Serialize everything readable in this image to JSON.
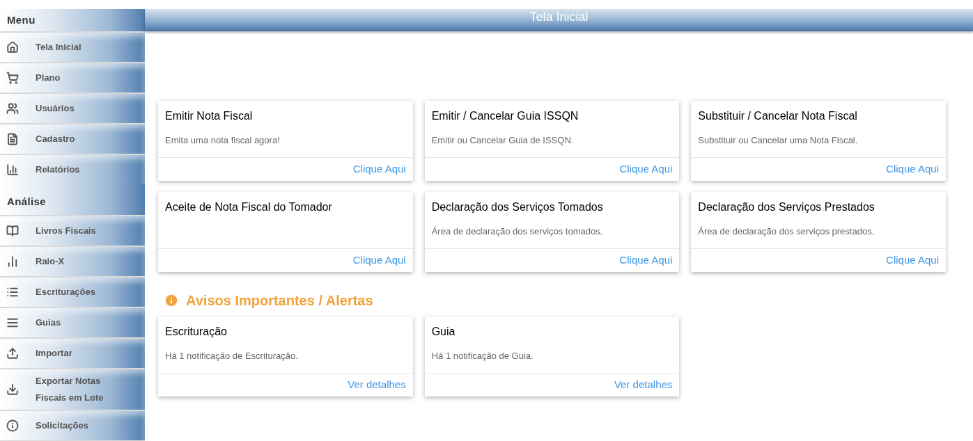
{
  "sidebar": {
    "sections": [
      {
        "title": "Menu",
        "items": [
          {
            "label": "Tela Inicial"
          },
          {
            "label": "Plano"
          },
          {
            "label": "Usuários"
          },
          {
            "label": "Cadastro"
          },
          {
            "label": "Relatórios"
          }
        ]
      },
      {
        "title": "Análise",
        "items": [
          {
            "label": "Livros Fiscais"
          },
          {
            "label": "Raio-X"
          },
          {
            "label": "Escriturações"
          },
          {
            "label": "Guias"
          },
          {
            "label": "Importar"
          },
          {
            "label": "Exportar Notas Fiscais em Lote"
          },
          {
            "label": "Solicitações"
          }
        ]
      }
    ]
  },
  "header": {
    "title": "Tela Inicial"
  },
  "cards": [
    {
      "title": "Emitir Nota Fiscal",
      "description": "Emita uma nota fiscal agora!",
      "link": "Clique Aqui"
    },
    {
      "title": "Emitir / Cancelar Guia ISSQN",
      "description": "Emitir ou Cancelar Guia de ISSQN.",
      "link": "Clique Aqui"
    },
    {
      "title": "Substituir / Cancelar Nota Fiscal",
      "description": "Substituir ou Cancelar uma Nota Fiscal.",
      "link": "Clique Aqui"
    },
    {
      "title": "Aceite de Nota Fiscal do Tomador",
      "link": "Clique Aqui"
    },
    {
      "title": "Declaração dos Serviços Tomados",
      "description": "Área de declaração dos serviços tomados.",
      "link": "Clique Aqui"
    },
    {
      "title": "Declaração dos Serviços Prestados",
      "description": "Área de declaração dos serviços prestados.",
      "link": "Clique Aqui"
    }
  ],
  "alerts": {
    "title": "Avisos Importantes / Alertas",
    "cards": [
      {
        "title": "Escrituração",
        "description": "Há 1 notificação de Escrituração.",
        "link": "Ver detalhes"
      },
      {
        "title": "Guia",
        "description": "Há 1 notificação de Guia.",
        "link": "Ver detalhes"
      }
    ]
  }
}
